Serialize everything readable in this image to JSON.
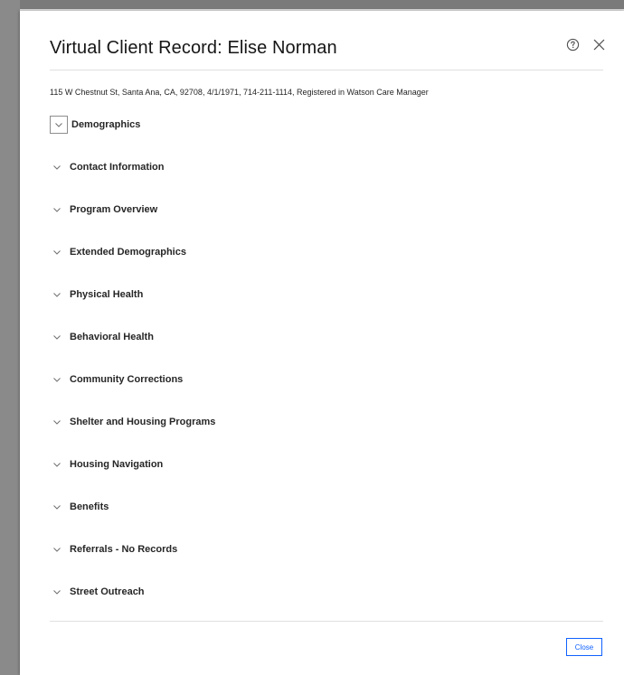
{
  "modal": {
    "title": "Virtual Client Record: Elise Norman",
    "subtitle": "115 W Chestnut St, Santa Ana, CA, 92708, 4/1/1971, 714-211-1114, Registered in Watson Care Manager",
    "close_button_label": "Close",
    "help_icon": "help-circle-icon",
    "close_icon": "close-x-icon"
  },
  "sections": [
    {
      "label": "Demographics",
      "focused": true
    },
    {
      "label": "Contact Information"
    },
    {
      "label": "Program Overview"
    },
    {
      "label": "Extended Demographics"
    },
    {
      "label": "Physical Health"
    },
    {
      "label": "Behavioral Health"
    },
    {
      "label": "Community Corrections"
    },
    {
      "label": "Shelter and Housing Programs"
    },
    {
      "label": "Housing Navigation"
    },
    {
      "label": "Benefits"
    },
    {
      "label": "Referrals - No Records"
    },
    {
      "label": "Street Outreach"
    }
  ],
  "colors": {
    "accent": "#0f62fe",
    "text": "#161616",
    "divider": "#e0e0e0"
  }
}
